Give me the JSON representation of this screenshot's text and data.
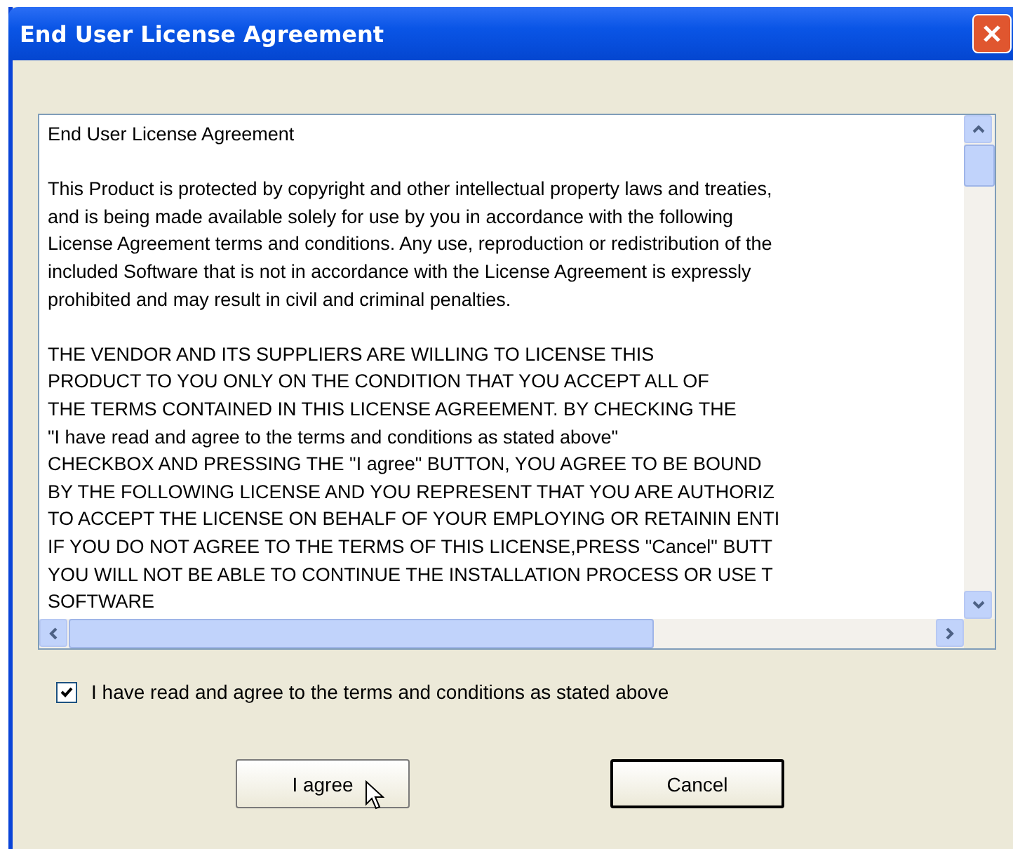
{
  "window": {
    "title": "End User License Agreement"
  },
  "license_text": {
    "heading": "End User License Agreement",
    "paragraphs": [
      "This Product is protected by copyright and other intellectual property laws and treaties,\nand is being made available solely for use by you in accordance with the following\nLicense Agreement terms and conditions. Any use, reproduction or redistribution of the\nincluded Software that is not in accordance with the License Agreement is expressly\nprohibited and may result in civil and criminal penalties.",
      "THE VENDOR AND ITS SUPPLIERS ARE WILLING TO LICENSE THIS\nPRODUCT TO YOU ONLY ON THE CONDITION THAT YOU ACCEPT ALL OF\nTHE TERMS CONTAINED IN THIS LICENSE AGREEMENT. BY CHECKING THE\n\"I have read and agree to the terms and conditions as stated above\"\nCHECKBOX AND PRESSING THE \"I agree\" BUTTON, YOU AGREE TO BE BOUND\nBY THE FOLLOWING LICENSE AND YOU REPRESENT THAT YOU ARE AUTHORIZ\nTO ACCEPT THE LICENSE ON BEHALF OF YOUR EMPLOYING OR RETAININ ENTI\nIF YOU DO NOT AGREE TO THE TERMS OF THIS LICENSE,PRESS \"Cancel\" BUTT\nYOU WILL NOT BE ABLE TO CONTINUE THE INSTALLATION PROCESS OR USE T\nSOFTWARE"
    ]
  },
  "agree_checkbox": {
    "label": "I have read and agree to the terms and conditions as stated above",
    "checked": true
  },
  "buttons": [
    {
      "label": "I agree",
      "kind": "default"
    },
    {
      "label": "Cancel",
      "kind": "focused"
    }
  ]
}
